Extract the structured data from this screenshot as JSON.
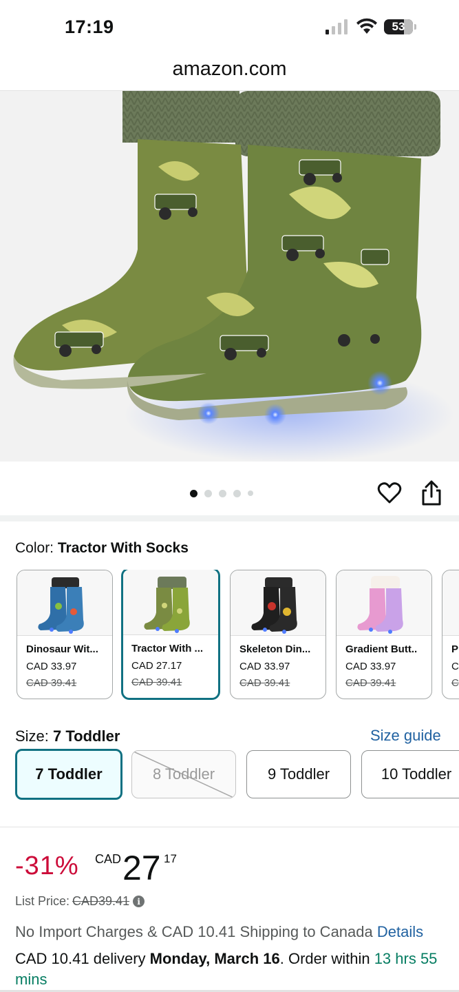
{
  "status_bar": {
    "time": "17:19",
    "battery": "53",
    "signal_icon": "cellular-signal-icon",
    "wifi_icon": "wifi-icon"
  },
  "browser": {
    "url": "amazon.com"
  },
  "gallery": {
    "image_count": 5,
    "active_index": 0,
    "favorite_icon": "heart-icon",
    "share_icon": "share-icon"
  },
  "color": {
    "label": "Color: ",
    "selected": "Tractor With Socks",
    "options": [
      {
        "name": "Dinosaur Wit...",
        "price": "CAD 33.97",
        "list_price": "CAD 39.41",
        "accent": "#2f6fa8"
      },
      {
        "name": "Tractor With ...",
        "price": "CAD 27.17",
        "list_price": "CAD 39.41",
        "accent": "#8aa53a"
      },
      {
        "name": "Skeleton Din...",
        "price": "CAD 33.97",
        "list_price": "CAD 39.41",
        "accent": "#c8342c"
      },
      {
        "name": "Gradient Butt..",
        "price": "CAD 33.97",
        "list_price": "CAD 39.41",
        "accent": "#e79ad0"
      },
      {
        "name": "P",
        "price": "C",
        "list_price": "C",
        "accent": "#999999"
      }
    ]
  },
  "size": {
    "label": "Size: ",
    "selected": "7 Toddler",
    "guide_label": "Size guide",
    "options": [
      "7 Toddler",
      "8 Toddler",
      "9 Toddler",
      "10 Toddler"
    ]
  },
  "price": {
    "discount": "-31%",
    "currency": "CAD",
    "whole": "27",
    "fraction": "17",
    "list_label": "List Price: ",
    "list_value": "CAD39.41",
    "info_icon": "i"
  },
  "shipping": {
    "text": "No Import Charges & CAD 10.41 Shipping to Canada ",
    "details_label": "Details"
  },
  "delivery": {
    "prefix": "CAD 10.41 delivery ",
    "date": "Monday, March 16",
    "middle": ". Order within ",
    "countdown": "13 hrs 55 mins"
  },
  "colors": {
    "teal_selected": "#107182",
    "link_blue": "#2162a1",
    "deal_red": "#cc0c39",
    "green": "#067d62"
  }
}
